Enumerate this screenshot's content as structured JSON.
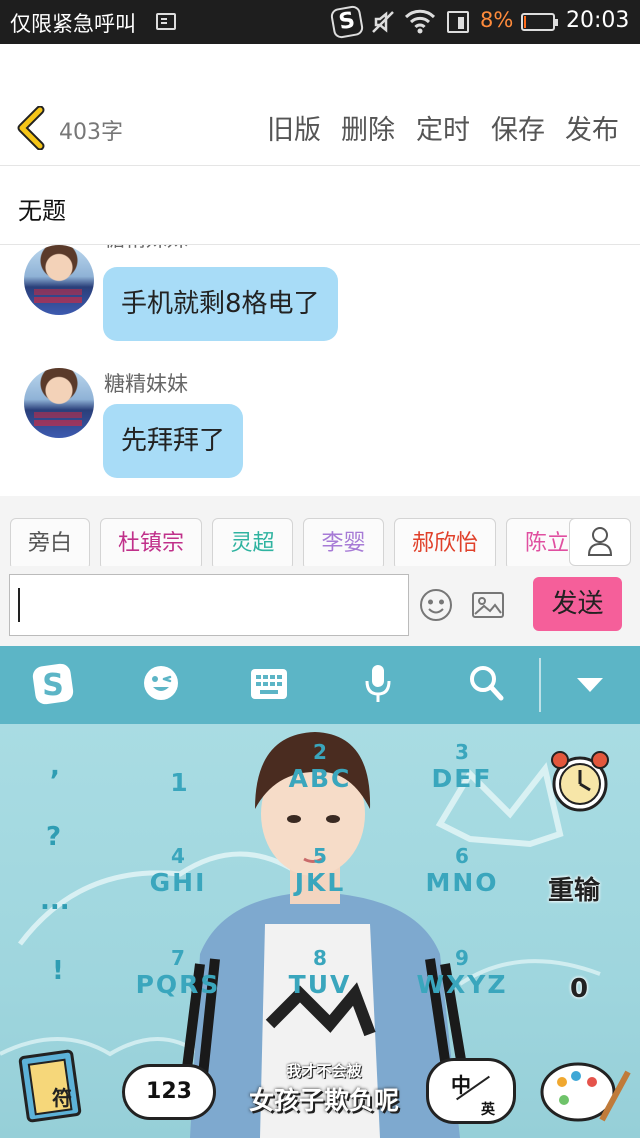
{
  "status_bar": {
    "carrier": "仅限紧急呼叫",
    "battery_percent": "8%",
    "battery_level": 0.08,
    "time": "20:03",
    "icons": [
      "sim-icon",
      "sogou-icon",
      "mute-icon",
      "wifi-icon",
      "sim-card-icon",
      "battery-icon"
    ]
  },
  "header": {
    "word_count": "403字",
    "actions": [
      "旧版",
      "删除",
      "定时",
      "保存",
      "发布"
    ]
  },
  "title": "无题",
  "chat": {
    "messages": [
      {
        "nick": "糖精妹妹",
        "text": "手机就剩8格电了"
      },
      {
        "nick": "糖精妹妹",
        "text": "先拜拜了"
      }
    ]
  },
  "roles": [
    {
      "label": "旁白",
      "color": "#555555"
    },
    {
      "label": "杜镇宗",
      "color": "#c0308a"
    },
    {
      "label": "灵超",
      "color": "#2fb3a0"
    },
    {
      "label": "李婴",
      "color": "#a77bd6"
    },
    {
      "label": "郝欣怡",
      "color": "#e0402a"
    },
    {
      "label": "陈立",
      "color": "#e04fa0"
    }
  ],
  "input": {
    "value": "",
    "send_label": "发送"
  },
  "keyboard": {
    "toolbar_icons": [
      "sogou-logo-icon",
      "emoji-face-icon",
      "keyboard-icon",
      "microphone-icon",
      "search-icon",
      "collapse-icon"
    ],
    "symbols": [
      ",",
      "?",
      "...",
      "!"
    ],
    "keys": [
      {
        "num": "1",
        "letters": ""
      },
      {
        "num": "2",
        "letters": "ABC"
      },
      {
        "num": "3",
        "letters": "DEF"
      },
      {
        "num": "4",
        "letters": "GHI"
      },
      {
        "num": "5",
        "letters": "JKL"
      },
      {
        "num": "6",
        "letters": "MNO"
      },
      {
        "num": "7",
        "letters": "PQRS"
      },
      {
        "num": "8",
        "letters": "TUV"
      },
      {
        "num": "9",
        "letters": "WXYZ"
      }
    ],
    "retype_label": "重输",
    "zero_label": "0",
    "symbol_key_label": "符",
    "numeric_key_label": "123",
    "logo_text_small": "我才不会被",
    "logo_text_big": "女孩子欺负呢",
    "lang_key_top": "中",
    "lang_key_bottom": "英",
    "colors": {
      "accent": "#5cb5c6",
      "send": "#f55f9a",
      "bubble": "#a8dcf7"
    }
  }
}
